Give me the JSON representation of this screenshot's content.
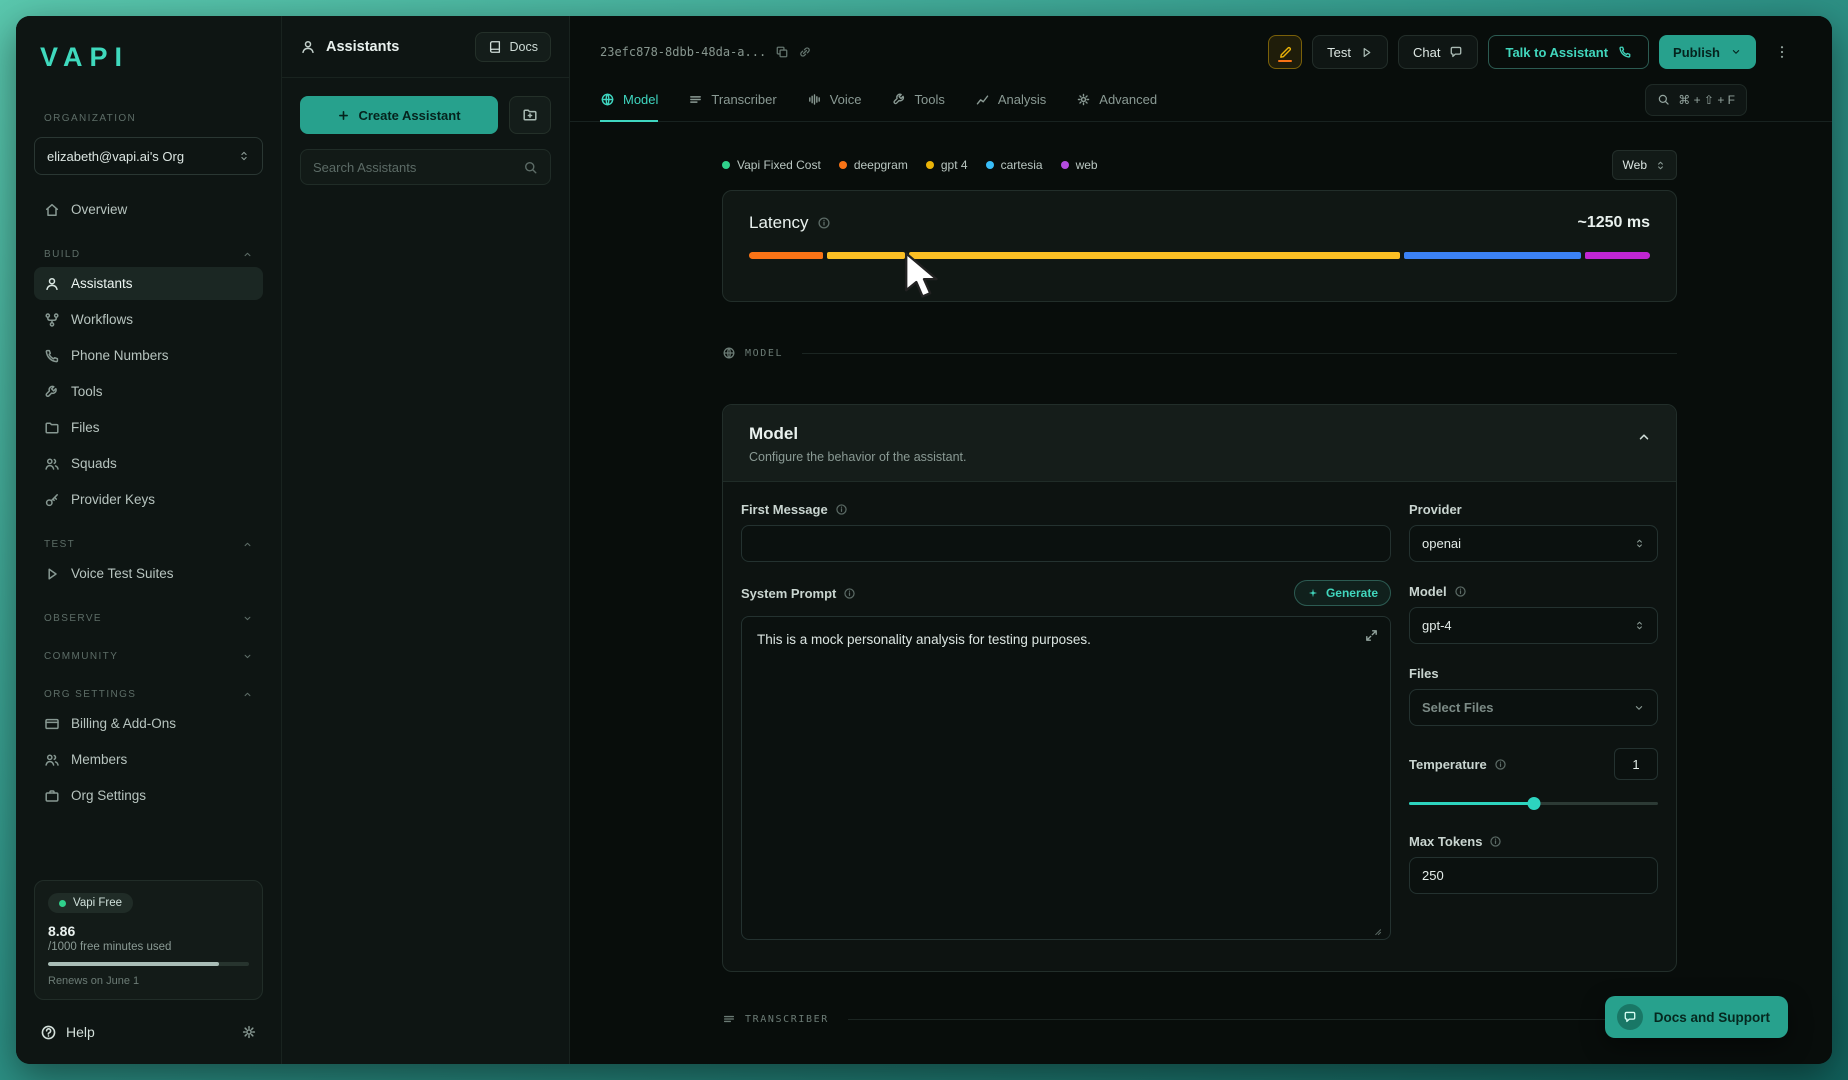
{
  "sidebar": {
    "logo": "VAPI",
    "organization_label": "ORGANIZATION",
    "org_selector_value": "elizabeth@vapi.ai's Org",
    "nav": {
      "overview": "Overview",
      "build_section": "BUILD",
      "assistants": "Assistants",
      "workflows": "Workflows",
      "phone_numbers": "Phone Numbers",
      "tools": "Tools",
      "files": "Files",
      "squads": "Squads",
      "provider_keys": "Provider Keys",
      "test_section": "TEST",
      "voice_test_suites": "Voice Test Suites",
      "observe_section": "OBSERVE",
      "community_section": "COMMUNITY",
      "org_settings_section": "ORG SETTINGS",
      "billing": "Billing & Add-Ons",
      "members": "Members",
      "org_settings": "Org Settings"
    },
    "plan_card": {
      "plan_name": "Vapi Free",
      "amount_used": "8.86",
      "quota_text": "/1000 free minutes used",
      "progress_fill": "85%",
      "renews_text": "Renews on June 1"
    },
    "help_label": "Help"
  },
  "assistants_panel": {
    "title": "Assistants",
    "docs_button": "Docs",
    "create_button_label": "Create Assistant",
    "search_placeholder": "Search Assistants"
  },
  "toolbar": {
    "assistant_id": "23efc878-8dbb-48da-a...",
    "test_label": "Test",
    "chat_label": "Chat",
    "talk_label": "Talk to Assistant",
    "publish_label": "Publish"
  },
  "tabs": [
    {
      "label": "Model"
    },
    {
      "label": "Transcriber"
    },
    {
      "label": "Voice"
    },
    {
      "label": "Tools"
    },
    {
      "label": "Analysis"
    },
    {
      "label": "Advanced"
    }
  ],
  "search_shortcut": "⌘ + ⇧ + F",
  "latency": {
    "title": "Latency",
    "value": "~1250 ms",
    "selector_value": "Web",
    "legend": [
      {
        "label": "Vapi Fixed Cost",
        "color": "#2fd08b"
      },
      {
        "label": "deepgram",
        "color": "#f97316"
      },
      {
        "label": "gpt 4",
        "color": "#eab308"
      },
      {
        "label": "cartesia",
        "color": "#38bdf8"
      },
      {
        "label": "web",
        "color": "#b44ce0"
      }
    ],
    "segments": [
      {
        "color": "#f97316",
        "share": 8.2
      },
      {
        "color": "#fbbf24",
        "share": 8.6
      },
      {
        "color": "#fbbf24",
        "share": 54.1
      },
      {
        "color": "#3b82f6",
        "share": 19.5
      },
      {
        "color": "#c026d3",
        "share": 7.2
      }
    ]
  },
  "model_section": {
    "divider_label": "MODEL",
    "title": "Model",
    "subtitle": "Configure the behavior of the assistant.",
    "first_message_label": "First Message",
    "first_message_value": "",
    "system_prompt_label": "System Prompt",
    "generate_label": "Generate",
    "system_prompt_value": "This is a mock personality analysis for testing purposes.",
    "provider_label": "Provider",
    "provider_value": "openai",
    "model_label": "Model",
    "model_value": "gpt-4",
    "files_label": "Files",
    "files_placeholder": "Select Files",
    "temperature_label": "Temperature",
    "temperature_value": "1",
    "temperature_fill": "50%",
    "max_tokens_label": "Max Tokens",
    "max_tokens_value": "250"
  },
  "transcriber_section": {
    "divider_label": "TRANSCRIBER"
  },
  "support_button_label": "Docs and Support"
}
